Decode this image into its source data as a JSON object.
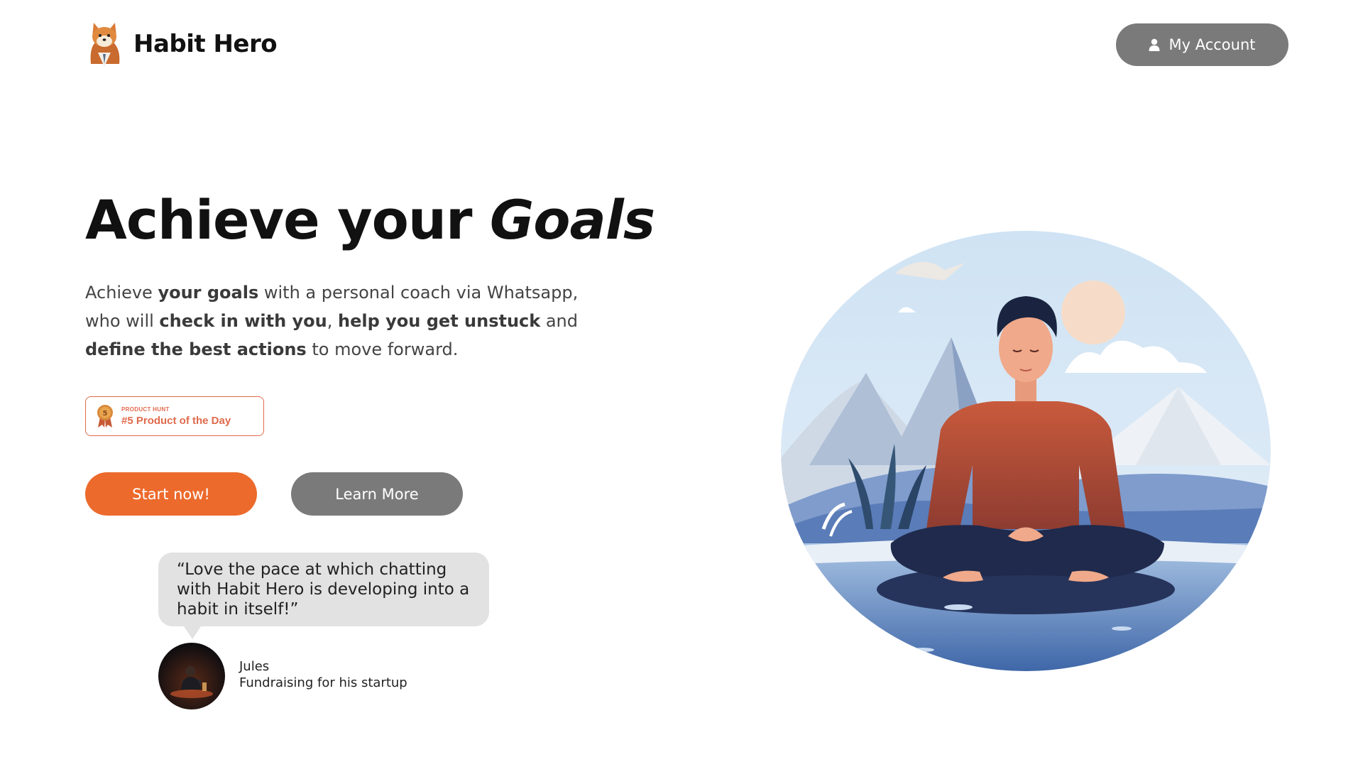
{
  "header": {
    "brand": "Habit Hero",
    "account_button": "My Account"
  },
  "hero": {
    "title_prefix": "Achieve your ",
    "title_accent": "Goals",
    "description": {
      "p1": "Achieve ",
      "b1": "your goals",
      "p2": " with a personal coach via Whatsapp, who will ",
      "b2": "check in with you",
      "p3": ", ",
      "b3": "help you get unstuck",
      "p4": " and ",
      "b4": "define the best actions",
      "p5": " to move forward."
    },
    "badge": {
      "label": "PRODUCT HUNT",
      "title": "#5 Product of the Day",
      "rank": "5"
    },
    "buttons": {
      "start": "Start now!",
      "learn": "Learn More"
    }
  },
  "testimonial": {
    "quote": "“Love the pace at which chatting with Habit Hero is developing into a habit in itself!”",
    "name": "Jules",
    "role": "Fundraising for his startup"
  },
  "icons": {
    "account": "user-icon",
    "badge": "medal-icon",
    "logo": "shiba-dog-logo"
  },
  "colors": {
    "primary": "#ec6a2c",
    "secondary_button": "#7a7a7a",
    "badge": "#e06a4c",
    "bubble": "#e2e2e2"
  }
}
